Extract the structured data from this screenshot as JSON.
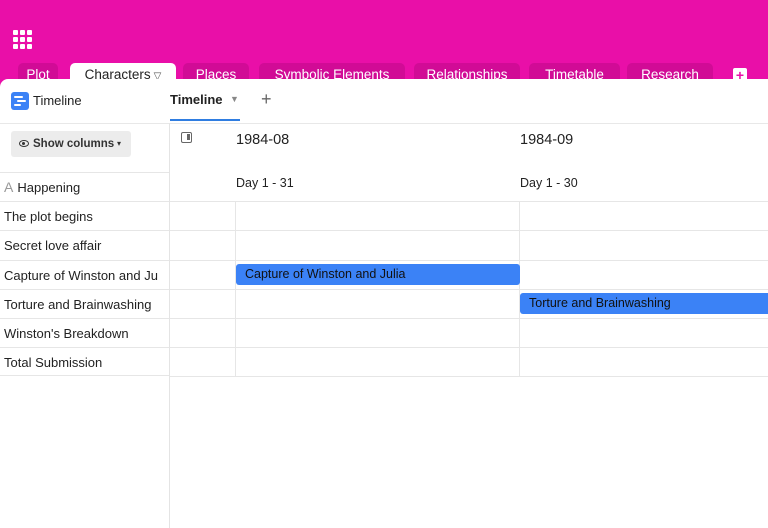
{
  "header": {
    "apps_icon": "grid-icon",
    "tabs": [
      {
        "label": "Plot"
      },
      {
        "label": "Characters"
      },
      {
        "label": "Places"
      },
      {
        "label": "Symbolic Elements"
      },
      {
        "label": "Relationships"
      },
      {
        "label": "Timetable"
      },
      {
        "label": "Research"
      }
    ],
    "active_tab": "Characters",
    "add_tab_label": "+"
  },
  "toolbar": {
    "title": "Timeline",
    "view_tab": "Timeline",
    "view_caret": "▼",
    "add_view": "+"
  },
  "left": {
    "show_columns": "Show columns",
    "show_columns_caret": "▾",
    "header_icon": "A",
    "header_label": "Happening",
    "rows": [
      {
        "label": "The plot begins"
      },
      {
        "label": "Secret love affair"
      },
      {
        "label": "Capture of Winston and Ju"
      },
      {
        "label": "Torture and Brainwashing"
      },
      {
        "label": "Winston's Breakdown"
      },
      {
        "label": "Total Submission"
      }
    ]
  },
  "timeline": {
    "months": [
      {
        "label": "1984-08",
        "days": "Day 1 - 31"
      },
      {
        "label": "1984-09",
        "days": "Day 1 - 30"
      }
    ],
    "bars": [
      {
        "label": "Capture of Winston and Julia",
        "row": 3
      },
      {
        "label": "Torture and Brainwashing",
        "row": 4
      }
    ]
  },
  "colors": {
    "brand": "#e90fa8",
    "bar": "#3b82f6",
    "accent": "#2f7de1"
  }
}
